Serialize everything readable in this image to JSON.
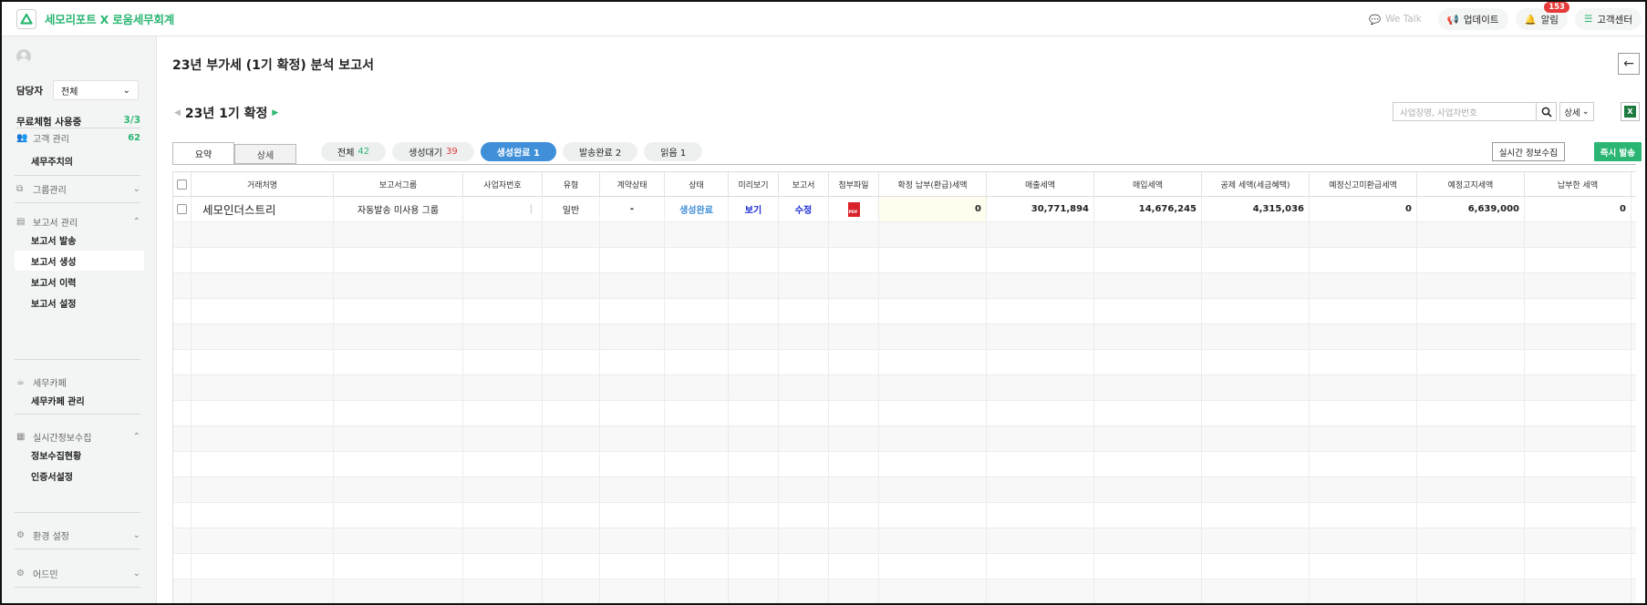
{
  "app": {
    "brand": "세모리포트 X 로움세무회계",
    "top_actions": [
      {
        "label": "We Talk",
        "icon": "chat-icon"
      },
      {
        "label": "업데이트",
        "icon": "megaphone-icon"
      },
      {
        "label": "알림",
        "icon": "bell-icon",
        "badge": "153"
      },
      {
        "label": "고객센터",
        "icon": "menu-icon"
      }
    ]
  },
  "sidebar": {
    "manager_label": "담당자",
    "manager_value": "전체",
    "trial_label": "무료체험 사용중",
    "trial_value": "3/3",
    "sections": {
      "customer": {
        "label": "고객 관리",
        "count": "62"
      },
      "customer_items": [
        "세무주치의"
      ],
      "group": {
        "label": "그룹관리"
      },
      "report": {
        "label": "보고서 관리"
      },
      "report_items": [
        "보고서 발송",
        "보고서 생성",
        "보고서 이력",
        "보고서 설정"
      ],
      "cafe": {
        "label": "세무카페"
      },
      "cafe_items": [
        "세무카페 관리"
      ],
      "realtime": {
        "label": "실시간정보수집"
      },
      "realtime_items": [
        "정보수집현황",
        "인증서설정"
      ],
      "env": {
        "label": "환경 설정"
      },
      "admin": {
        "label": "어드민"
      }
    }
  },
  "main": {
    "title": "23년 부가세 (1기 확정) 분석 보고서",
    "period": "23년 1기 확정",
    "search_placeholder": "사업장명, 사업자번호",
    "detail_dropdown": "상세",
    "tabs": [
      "요약",
      "상세"
    ],
    "chips": [
      {
        "label": "전체",
        "count": "42"
      },
      {
        "label": "생성대기",
        "count": "39"
      },
      {
        "label": "생성완료 1",
        "count": ""
      },
      {
        "label": "발송완료 2",
        "count": ""
      },
      {
        "label": "읽음 1",
        "count": ""
      }
    ],
    "btn_collect": "실시간 정보수집",
    "btn_send": "즉시 발송"
  },
  "table": {
    "columns": [
      "거래처명",
      "보고서그룹",
      "사업자번호",
      "유형",
      "계약상태",
      "상태",
      "미리보기",
      "보고서",
      "첨부파일",
      "확정 납부(환급)세액",
      "매출세액",
      "매입세액",
      "공제 세액(세금혜택)",
      "예정신고미환급세액",
      "예정고지세액",
      "납부한 세액"
    ],
    "rows": [
      {
        "name": "세모인더스트리",
        "group": "자동발송 미사용 그룹",
        "bizno": "",
        "type": "일반",
        "contract": "-",
        "status": "생성완료",
        "preview": "보기",
        "report": "수정",
        "final_tax": "0",
        "sales_tax": "30,771,894",
        "purchase_tax": "14,676,245",
        "deduction": "4,315,036",
        "unrefunded": "0",
        "notice_tax": "6,639,000",
        "paid_tax": "0"
      }
    ]
  }
}
